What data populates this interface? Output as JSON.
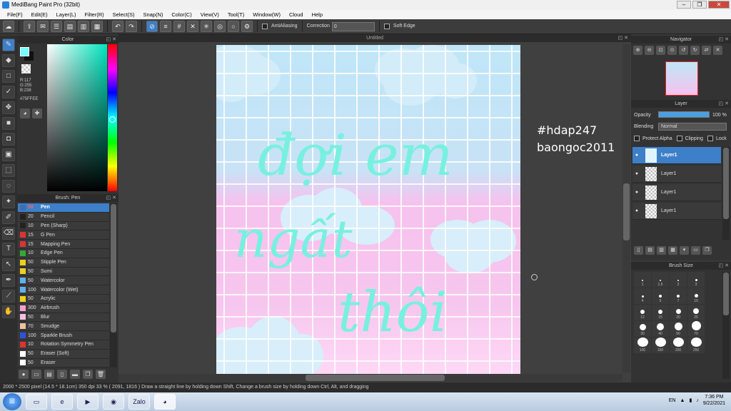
{
  "window": {
    "title": "MediBang Paint Pro (32bit)"
  },
  "menu": [
    "File(F)",
    "Edit(E)",
    "Layer(L)",
    "Filter(R)",
    "Select(S)",
    "Snap(N)",
    "Color(C)",
    "View(V)",
    "Tool(T)",
    "Window(W)",
    "Cloud",
    "Help"
  ],
  "toolbar": {
    "antialiasing": "AntiAliasing",
    "correction_label": "Correction",
    "correction_value": "0",
    "soft_edge": "Soft Edge"
  },
  "color_panel": {
    "title": "Color",
    "r": "R:117",
    "g": "G:255",
    "b": "B:238",
    "hex": "#75FFEE",
    "fg_color": "#75fffe"
  },
  "brush_panel": {
    "title": "Brush: Pen",
    "items": [
      {
        "size": "50",
        "name": "Pen",
        "color": "#3a6fb0"
      },
      {
        "size": "20",
        "name": "Pencil",
        "color": "#222222"
      },
      {
        "size": "10",
        "name": "Pen (Sharp)",
        "color": "#222222"
      },
      {
        "size": "15",
        "name": "G Pen",
        "color": "#dd3333"
      },
      {
        "size": "15",
        "name": "Mapping Pen",
        "color": "#dd3333"
      },
      {
        "size": "10",
        "name": "Edge Pen",
        "color": "#33aa33"
      },
      {
        "size": "50",
        "name": "Stipple Pen",
        "color": "#f0d020"
      },
      {
        "size": "50",
        "name": "Sumi",
        "color": "#f0d020"
      },
      {
        "size": "50",
        "name": "Watercolor",
        "color": "#60b0f0"
      },
      {
        "size": "100",
        "name": "Watercolor (Wet)",
        "color": "#60b0f0"
      },
      {
        "size": "50",
        "name": "Acrylic",
        "color": "#f0d020"
      },
      {
        "size": "300",
        "name": "Airbrush",
        "color": "#f0a0d0"
      },
      {
        "size": "50",
        "name": "Blur",
        "color": "#f0c0e0"
      },
      {
        "size": "70",
        "name": "Smudge",
        "color": "#f0c0a0"
      },
      {
        "size": "100",
        "name": "Sparkle Brush",
        "color": "#3050e0"
      },
      {
        "size": "10",
        "name": "Rotation Symmetry Pen",
        "color": "#dd3333"
      },
      {
        "size": "50",
        "name": "Eraser (Soft)",
        "color": "#ffffff"
      },
      {
        "size": "50",
        "name": "Eraser",
        "color": "#ffffff"
      }
    ]
  },
  "document": {
    "title": "Untitled"
  },
  "canvas_text": {
    "line1": "đợi em",
    "line2": "ngất",
    "line3": "thôi"
  },
  "watermark": {
    "line1": "#hdap247",
    "line2": "baongoc2011"
  },
  "navigator": {
    "title": "Navigator"
  },
  "layer_panel": {
    "title": "Layer",
    "opacity_label": "Opacity",
    "opacity_value": "100 %",
    "opacity_fraction": 1.0,
    "blending_label": "Blending",
    "blending_value": "Normal",
    "protect_alpha": "Protect Alpha",
    "clipping": "Clipping",
    "lock": "Lock",
    "layers": [
      {
        "name": "Layer1",
        "selected": true
      },
      {
        "name": "Layer1",
        "selected": false
      },
      {
        "name": "Layer1",
        "selected": false
      },
      {
        "name": "Layer1",
        "selected": false
      }
    ]
  },
  "brush_size_panel": {
    "title": "Brush Size",
    "sizes": [
      "1",
      "1.5",
      "2",
      "3",
      "4",
      "5",
      "7",
      "10",
      "12",
      "15",
      "20",
      "25",
      "30",
      "40",
      "50",
      "70",
      "100",
      "150",
      "200",
      "250"
    ]
  },
  "status": {
    "text": "2000 * 2500 pixel  (14.5 * 18.1cm)  350 dpi  33 %  ( 2091, 1816 )  Draw a straight line by holding down Shift, Change a brush size by holding down Ctrl, Alt, and dragging"
  },
  "taskbar": {
    "lang": "EN",
    "time": "7:36 PM",
    "date": "9/22/2021",
    "zalo": "Zalo"
  }
}
